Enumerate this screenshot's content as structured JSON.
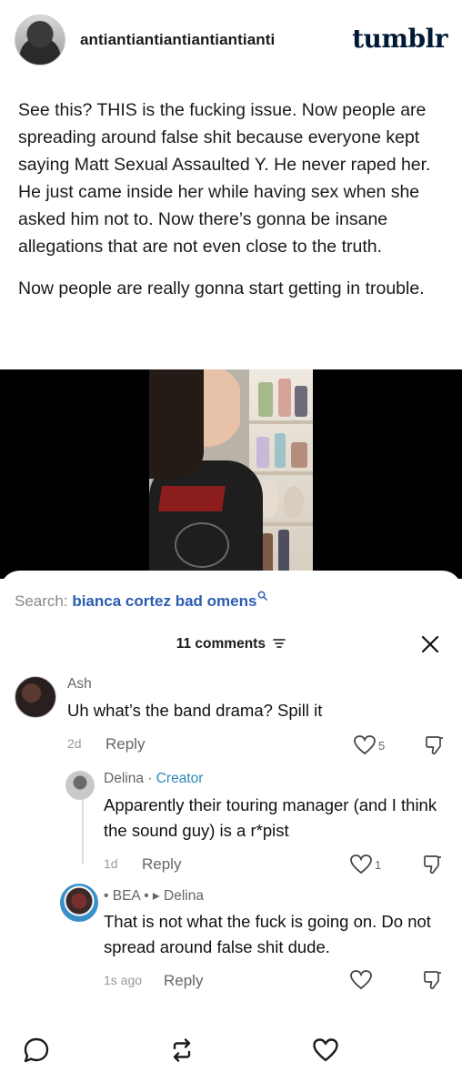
{
  "post": {
    "username": "antiantiantiantiantiantianti",
    "brand": "tumblr",
    "paragraphs": [
      "See this? THIS is the fucking issue. Now people are spreading around false shit because everyone kept saying Matt Sexual Assaulted Y. He never raped her. He just came inside her while having sex when she asked him not to. Now there’s gonna be insane allegations that are not even close to the truth.",
      "Now people are really gonna start getting in trouble."
    ]
  },
  "sheet": {
    "search_label": "Search:",
    "search_term": "bianca cortez bad omens",
    "comments_count": "11 comments"
  },
  "comments": [
    {
      "name": "Ash",
      "text": "Uh what’s the band drama? Spill it",
      "time": "2d",
      "reply_label": "Reply",
      "likes": "5"
    },
    {
      "name": "Delina",
      "separator": " · ",
      "badge": "Creator",
      "text": "Apparently their touring manager (and I think the sound guy) is a r*pist",
      "time": "1d",
      "reply_label": "Reply",
      "likes": "1"
    },
    {
      "name": "• BEA • ▸ Delina",
      "text": "That is not what the fuck is going on. Do not spread around false shit dude.",
      "time": "1s ago",
      "reply_label": "Reply",
      "likes": ""
    }
  ],
  "icons": {
    "search": "search-icon",
    "filter": "filter-icon",
    "close": "close-icon",
    "like": "heart-icon",
    "dislike": "dislike-icon",
    "comment": "comment-bubble-icon",
    "reblog": "reblog-icon",
    "heart": "heart-icon"
  },
  "colors": {
    "brand": "#001935",
    "link": "#2a5db0",
    "creator": "#2a8ab8"
  }
}
